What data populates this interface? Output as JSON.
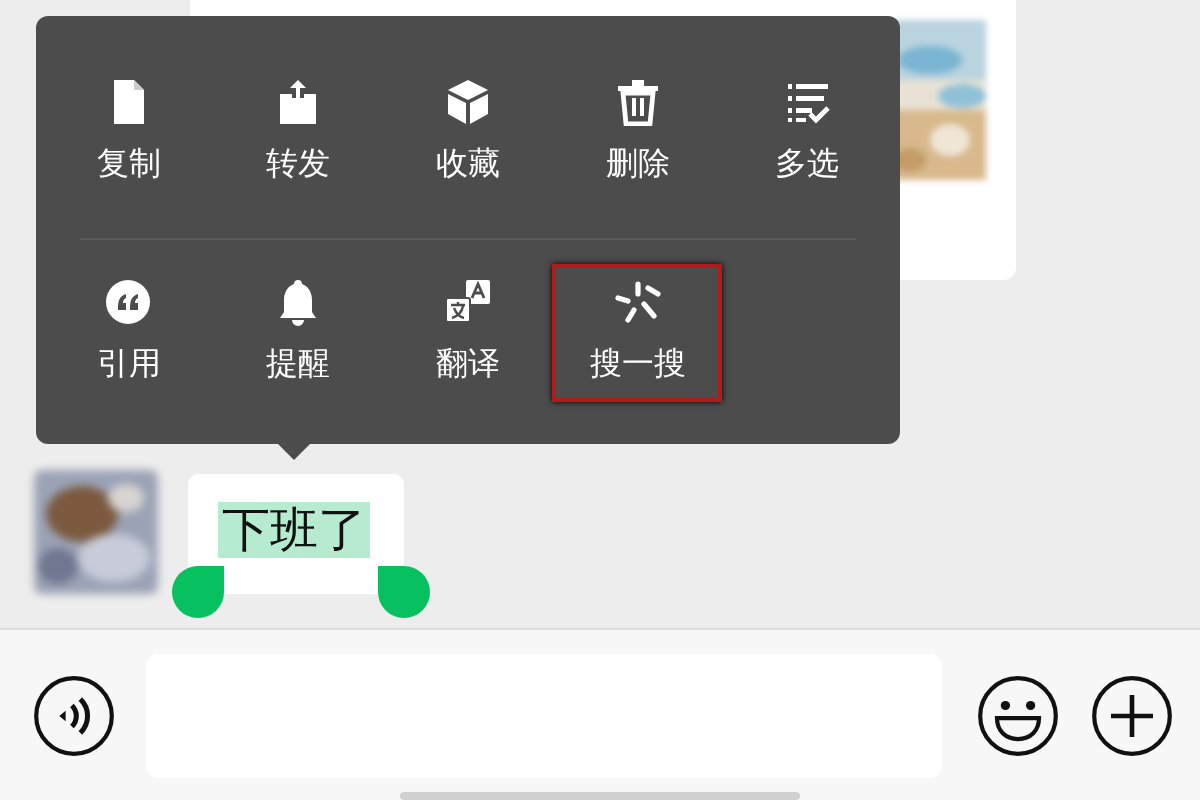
{
  "context_menu": {
    "rows": [
      [
        {
          "kind": "copy",
          "label": "复制",
          "highlighted": false
        },
        {
          "kind": "forward",
          "label": "转发",
          "highlighted": false
        },
        {
          "kind": "favorite",
          "label": "收藏",
          "highlighted": false
        },
        {
          "kind": "delete",
          "label": "删除",
          "highlighted": false
        },
        {
          "kind": "multiselect",
          "label": "多选",
          "highlighted": false
        }
      ],
      [
        {
          "kind": "quote",
          "label": "引用",
          "highlighted": false
        },
        {
          "kind": "remind",
          "label": "提醒",
          "highlighted": false
        },
        {
          "kind": "translate",
          "label": "翻译",
          "highlighted": false
        },
        {
          "kind": "search",
          "label": "搜一搜",
          "highlighted": true
        }
      ]
    ]
  },
  "message": {
    "text": "下班了",
    "selected": true
  }
}
